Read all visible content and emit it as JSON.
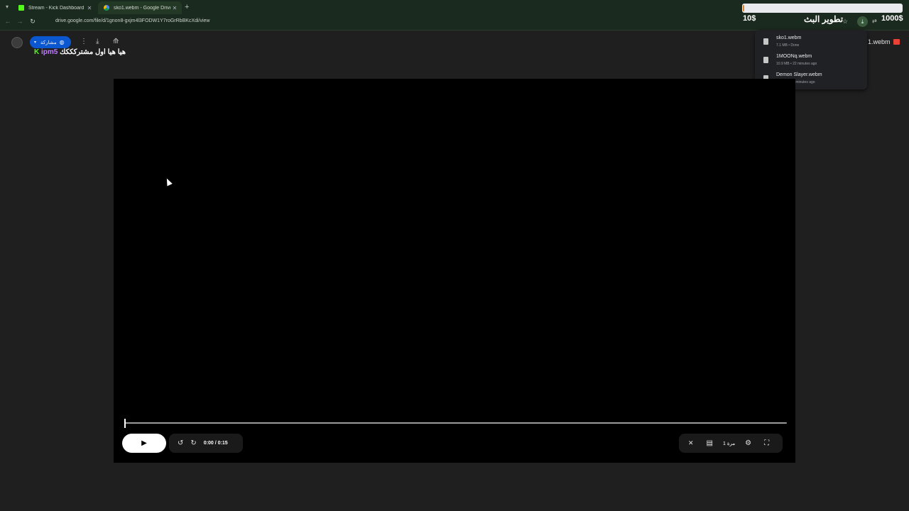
{
  "browser": {
    "tabs": [
      {
        "label": "Stream - Kick Dashboard",
        "favicon": "kick-favicon",
        "active": false
      },
      {
        "label": "sko1.webm - Google Drive",
        "favicon": "drive-favicon",
        "active": true
      }
    ],
    "new_tab": "+",
    "tab_close": "✕",
    "url": "drive.google.com/file/d/1gnon8-gxjm4l3FODW1Y7roGrRbBKcXdi/view",
    "progress_fraction": 0.01
  },
  "stream_overlay": {
    "left_amount": "10$",
    "title": "تطوير البث",
    "right_amount": "1000$",
    "subscriber_line": "هيا هيا اول مشتركككك",
    "username": "ipm5",
    "k_logo": "K"
  },
  "drive": {
    "share_label": "مشاركة",
    "file_label": "1.webm"
  },
  "downloads": [
    {
      "name": "sko1.webm",
      "status": "7.1 MB • Done"
    },
    {
      "name": "1MOONq.webm",
      "status": "10.9 MB • 22 minutes ago"
    },
    {
      "name": "Demon Slayer.webm",
      "status": "7.4 MB • 26 minutes ago"
    }
  ],
  "player": {
    "time": "0:00 / 0:15",
    "speed": "1 مرة",
    "progress_fraction": 0.0
  },
  "icons": {
    "back": "←",
    "forward": "→",
    "reload": "↻",
    "star": "☆",
    "download": "⤓",
    "play": "▶",
    "rewind": "↺",
    "forward10": "↻",
    "mute": "🔇",
    "captions": "▤",
    "settings": "⚙",
    "fullscreen": "⛶",
    "more": "⋮",
    "add_to_drive": "⟰",
    "globe": "◍",
    "chevron": "▾"
  }
}
